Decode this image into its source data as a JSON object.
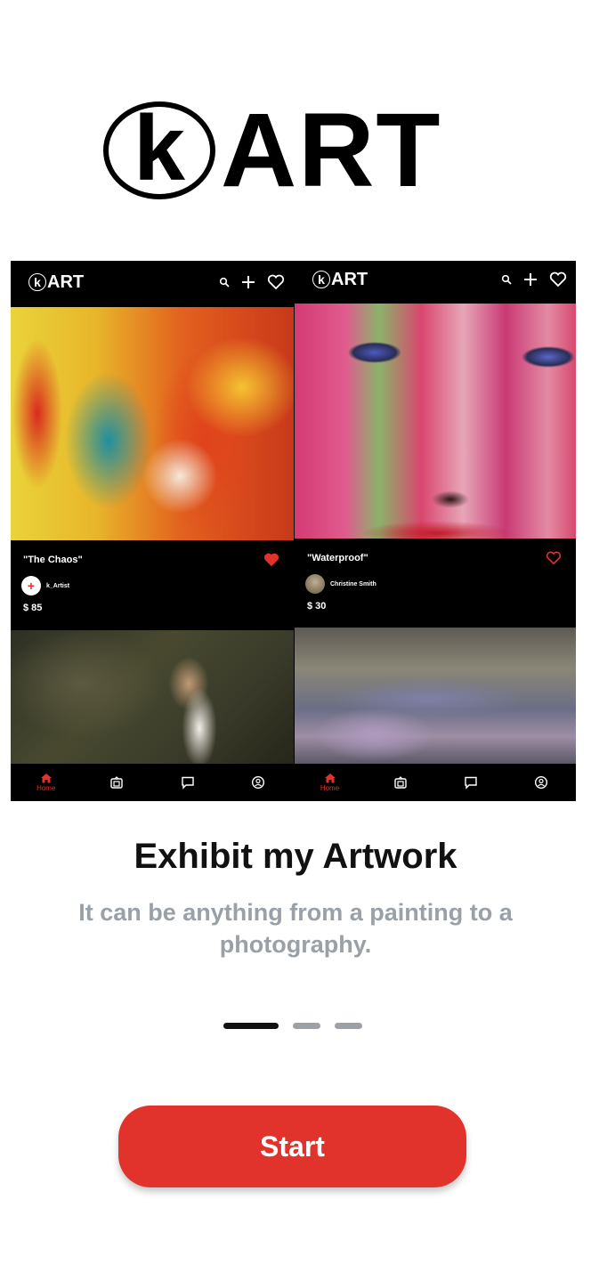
{
  "brand": {
    "mark": "k",
    "name": "ART"
  },
  "preview": {
    "left": {
      "logo_mark": "k",
      "logo_text": "ART",
      "card": {
        "title": "\"The Chaos\"",
        "artist": "k_Artist",
        "avatar_symbol": "+",
        "price": "$ 85",
        "liked": true
      },
      "tab_home": "Home"
    },
    "right": {
      "logo_mark": "k",
      "logo_text": "ART",
      "card": {
        "title": "\"Waterproof\"",
        "artist": "Christine Smith",
        "price": "$ 30",
        "liked": false
      },
      "tab_home": "Home"
    },
    "header_icons": [
      "search-icon",
      "plus-icon",
      "heart-icon"
    ],
    "tab_icons": [
      "home-icon",
      "gallery-icon",
      "chat-icon",
      "profile-icon"
    ]
  },
  "onboarding": {
    "title": "Exhibit my Artwork",
    "subtitle": "It can be anything from a painting to a photography.",
    "page_index": 1,
    "page_count": 3
  },
  "cta": {
    "label": "Start"
  },
  "colors": {
    "accent": "#e2322c",
    "subtitle": "#9aa0a8",
    "dot_inactive": "#9ca1a8",
    "dot_active": "#111111"
  }
}
